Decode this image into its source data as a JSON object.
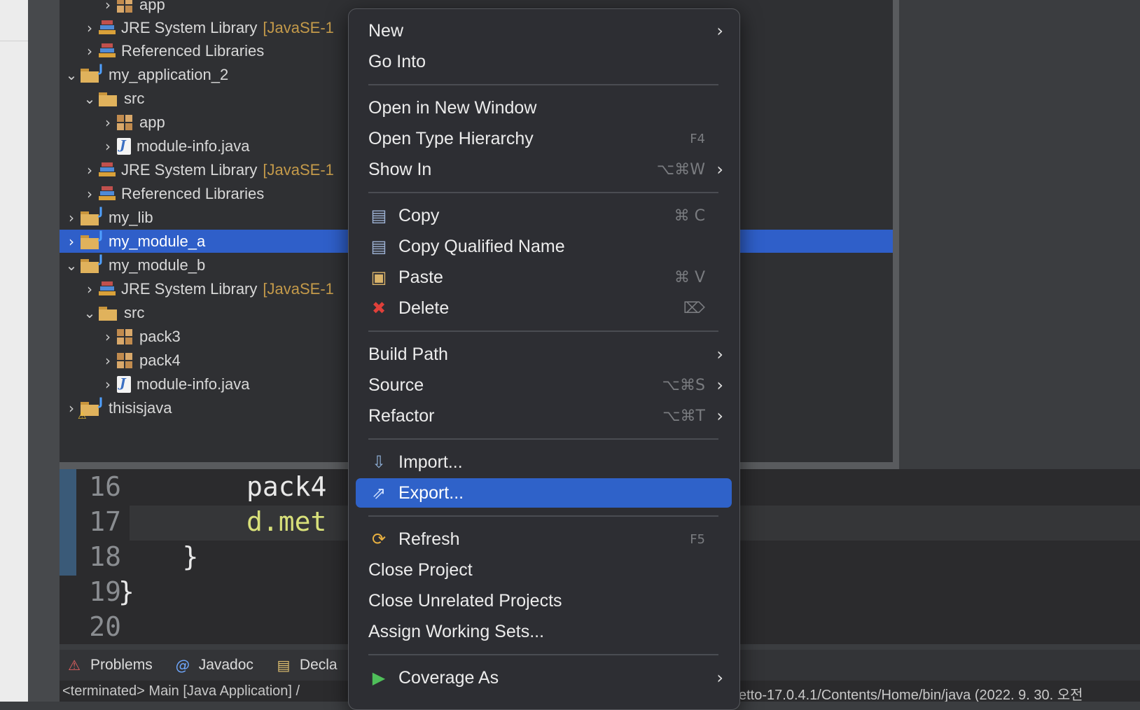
{
  "explorer": {
    "rows": [
      {
        "chevron": "›",
        "icon": "package-icon",
        "label": "app",
        "decor": ""
      },
      {
        "chevron": "›",
        "icon": "library-icon",
        "label": "JRE System Library",
        "decor": "[JavaSE-1"
      },
      {
        "chevron": "›",
        "icon": "library-icon",
        "label": "Referenced Libraries",
        "decor": ""
      },
      {
        "chevron": "⌄",
        "icon": "java-project-icon",
        "label": "my_application_2",
        "decor": ""
      },
      {
        "chevron": "⌄",
        "icon": "source-folder-icon",
        "label": "src",
        "decor": ""
      },
      {
        "chevron": "›",
        "icon": "package-icon",
        "label": "app",
        "decor": ""
      },
      {
        "chevron": "›",
        "icon": "java-file-icon",
        "label": "module-info.java",
        "decor": ""
      },
      {
        "chevron": "›",
        "icon": "library-icon",
        "label": "JRE System Library",
        "decor": "[JavaSE-1"
      },
      {
        "chevron": "›",
        "icon": "library-icon",
        "label": "Referenced Libraries",
        "decor": ""
      },
      {
        "chevron": "›",
        "icon": "java-project-icon",
        "label": "my_lib",
        "decor": ""
      },
      {
        "chevron": "›",
        "icon": "java-project-icon",
        "label": "my_module_a",
        "decor": "",
        "selected": true
      },
      {
        "chevron": "⌄",
        "icon": "java-project-icon",
        "label": "my_module_b",
        "decor": ""
      },
      {
        "chevron": "›",
        "icon": "library-icon",
        "label": "JRE System Library",
        "decor": "[JavaSE-1"
      },
      {
        "chevron": "⌄",
        "icon": "source-folder-icon",
        "label": "src",
        "decor": ""
      },
      {
        "chevron": "›",
        "icon": "package-icon",
        "label": "pack3",
        "decor": ""
      },
      {
        "chevron": "›",
        "icon": "package-icon",
        "label": "pack4",
        "decor": ""
      },
      {
        "chevron": "›",
        "icon": "java-file-icon",
        "label": "module-info.java",
        "decor": ""
      },
      {
        "chevron": "›",
        "icon": "java-project-warning-icon",
        "label": "thisisjava",
        "decor": ""
      }
    ]
  },
  "editor": {
    "lines": [
      {
        "num": "16",
        "code": "        pack4"
      },
      {
        "num": "17",
        "code": "        d.met"
      },
      {
        "num": "18",
        "code": "    }"
      },
      {
        "num": "19",
        "code": "}"
      },
      {
        "num": "20",
        "code": ""
      }
    ]
  },
  "bottom_tabs": {
    "problems": "Problems",
    "javadoc": "Javadoc",
    "declaration": "Decla"
  },
  "console": {
    "left": "<terminated> Main [Java Application] /",
    "right": "etto-17.0.4.1/Contents/Home/bin/java  (2022. 9. 30. 오전"
  },
  "context_menu": {
    "new": {
      "label": "New"
    },
    "go_into": {
      "label": "Go Into"
    },
    "open_new_window": {
      "label": "Open in New Window"
    },
    "open_type_hierarchy": {
      "label": "Open Type Hierarchy",
      "shortcut": "F4"
    },
    "show_in": {
      "label": "Show In",
      "shortcut": "⌥⌘W"
    },
    "copy": {
      "label": "Copy",
      "shortcut": "⌘ C"
    },
    "copy_qualified_name": {
      "label": "Copy Qualified Name"
    },
    "paste": {
      "label": "Paste",
      "shortcut": "⌘ V"
    },
    "delete": {
      "label": "Delete",
      "shortcut": "⌦"
    },
    "build_path": {
      "label": "Build Path"
    },
    "source": {
      "label": "Source",
      "shortcut": "⌥⌘S"
    },
    "refactor": {
      "label": "Refactor",
      "shortcut": "⌥⌘T"
    },
    "import": {
      "label": "Import..."
    },
    "export": {
      "label": "Export..."
    },
    "refresh": {
      "label": "Refresh",
      "shortcut": "F5"
    },
    "close_project": {
      "label": "Close Project"
    },
    "close_unrelated": {
      "label": "Close Unrelated Projects"
    },
    "assign_working_sets": {
      "label": "Assign Working Sets..."
    },
    "coverage_as": {
      "label": "Coverage As"
    }
  },
  "colors": {
    "selection": "#2f5fc9",
    "menu_highlight": "#2f62c9",
    "menu_bg": "#2d2e33",
    "editor_bg": "#2b2b2d"
  }
}
